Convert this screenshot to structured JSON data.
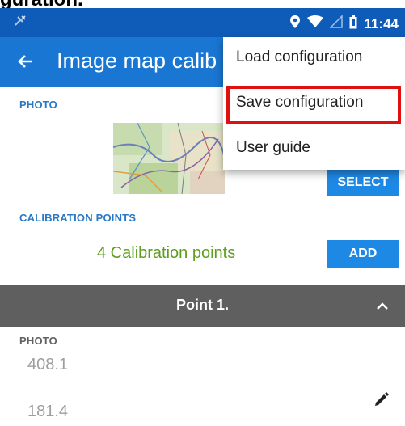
{
  "top_caption": "guration.",
  "status_bar": {
    "time": "11:44"
  },
  "app_bar": {
    "title": "Image map calib"
  },
  "photo_section": {
    "label": "PHOTO",
    "select_label": "SELECT"
  },
  "calibration_section": {
    "label": "CALIBRATION POINTS",
    "count_text": "4 Calibration points",
    "add_label": "ADD"
  },
  "point_panel": {
    "title": "Point 1.",
    "section_label": "PHOTO",
    "x_value": "408.1",
    "y_value": "181.4"
  },
  "overflow_menu": {
    "items": [
      {
        "label": "Load configuration"
      },
      {
        "label": "Save configuration"
      },
      {
        "label": "User guide"
      }
    ]
  },
  "colors": {
    "app_bar": "#1976d2",
    "status_bar": "#0f5cb8",
    "accent_green": "#5e9e1f",
    "button_blue": "#1e88e5",
    "highlight_red": "#e01010",
    "point_bar": "#5f5f5f"
  }
}
